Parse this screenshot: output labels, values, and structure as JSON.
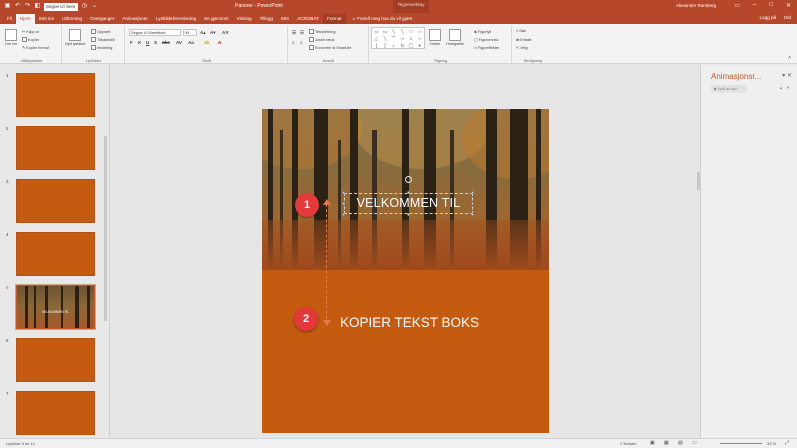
{
  "window": {
    "title": "Panorer - PowerPoint",
    "user": "Alexander Ramberg",
    "context_group": "Tegneverktøy"
  },
  "qat": {
    "font_name": "Segoe UI Sem"
  },
  "tabs": [
    "Fil",
    "Hjem",
    "Sett inn",
    "Utforming",
    "Overganger",
    "Animasjoner",
    "Lysbildefremvisning",
    "Se gjennom",
    "Visning",
    "Tillegg",
    "MIX",
    "ACROBAT",
    "Format"
  ],
  "tell_me": "Fortell meg hva du vil gjøre",
  "tab_right": {
    "signin": "Logg på",
    "share": "Del"
  },
  "ribbon": {
    "clipboard": {
      "label": "Utklippstavle",
      "paste": "Lim inn",
      "cut": "Klipp ut",
      "copy": "Kopier",
      "format_painter": "Kopier format"
    },
    "slides": {
      "label": "Lysbilder",
      "new_slide": "Nytt lysbilde",
      "layout": "Oppsett",
      "reset": "Tilbakestill",
      "section": "Inndeling"
    },
    "font": {
      "label": "Skrift",
      "font_name": "Segoe UI Semibold",
      "font_size": "54"
    },
    "paragraph": {
      "label": "Avsnitt",
      "text_direction": "Tekstretning",
      "align_text": "Juster tekst",
      "smartart": "Konverter til SmartArt"
    },
    "drawing": {
      "label": "Tegning",
      "arrange": "Ordne",
      "quick_styles": "Hurtigstiler",
      "fill": "Figurfyll",
      "outline": "Figuromriss",
      "effects": "Figureffekter"
    },
    "editing": {
      "label": "Redigering",
      "find": "Søk",
      "replace": "Erstatt",
      "select": "Velg"
    }
  },
  "thumbnails": [
    {
      "num": "1",
      "text": ""
    },
    {
      "num": "2",
      "text": ""
    },
    {
      "num": "3",
      "text": ""
    },
    {
      "num": "4",
      "text": ""
    },
    {
      "num": "5",
      "text": "VELKOMMEN TIL"
    },
    {
      "num": "6",
      "text": ""
    },
    {
      "num": "7",
      "text": ""
    }
  ],
  "slide": {
    "title_text": "VELKOMMEN TIL",
    "copy_text": "KOPIER TEKST BOKS"
  },
  "badges": {
    "b1": "1",
    "b2": "2"
  },
  "animation_pane": {
    "title": "Animasjonsr...",
    "play": "Spill av alle"
  },
  "status": {
    "slide_info": "Lysbilde 5 av 14",
    "notes": "Notater",
    "zoom": "33 %"
  },
  "colors": {
    "brand": "#b7472a",
    "slide_bg": "#c55a11",
    "badge": "#e23a3a"
  }
}
